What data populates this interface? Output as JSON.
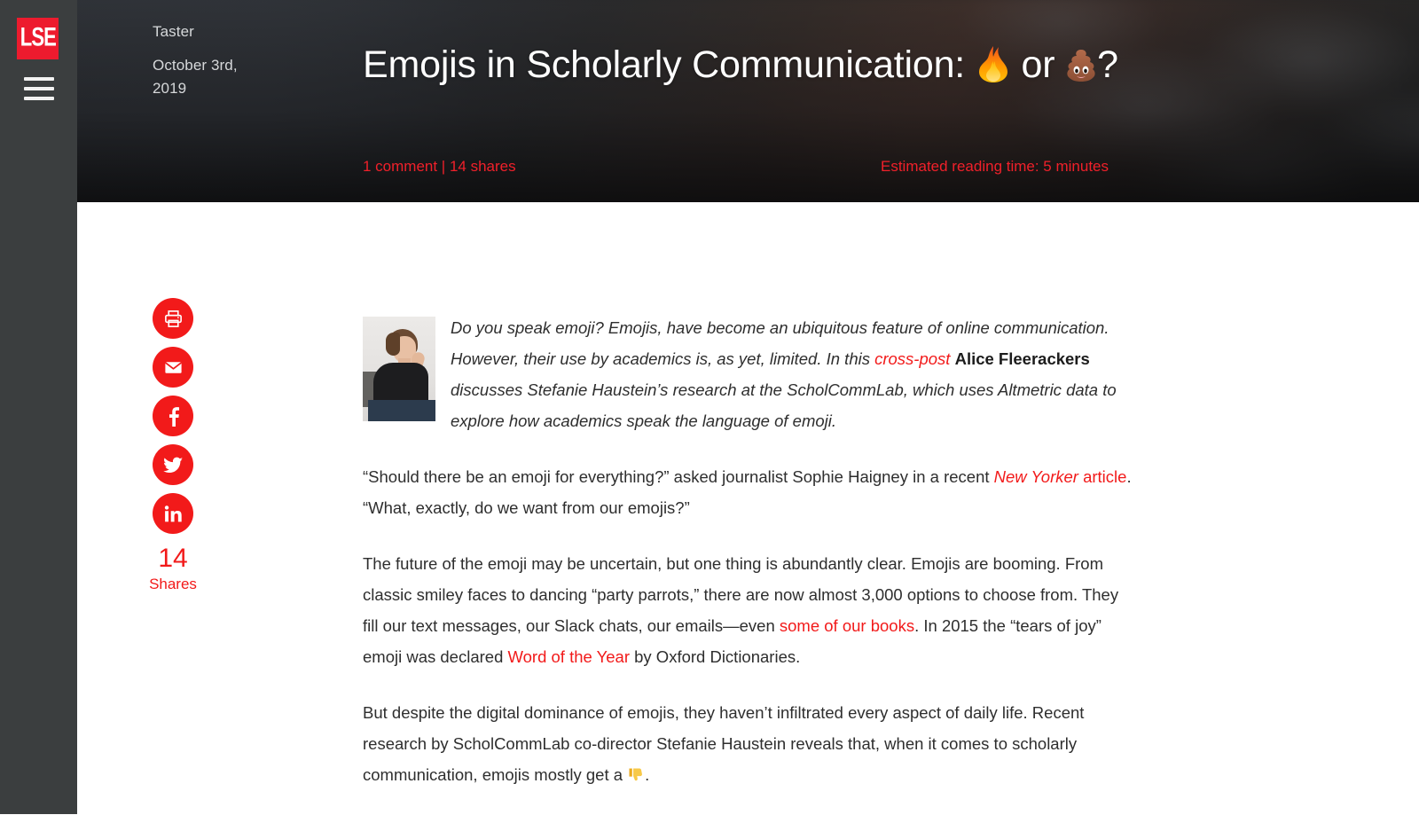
{
  "site": {
    "logo_text": "LSE",
    "logo_name": "lse-logo",
    "menu_icon": "hamburger-icon"
  },
  "banner": {
    "kicker": "Taster",
    "date": "October 3rd, 2019",
    "title_part1": "Emojis in Scholarly Communication: ",
    "title_emoji1": "fire-emoji",
    "title_part2": " or ",
    "title_emoji2": "poop-emoji",
    "title_part3": "?",
    "title_full": "Emojis in Scholarly Communication: 🔥 or 💩?",
    "meta_left": "1 comment | 14 shares",
    "meta_right": "Estimated reading time: 5 minutes",
    "comment_count": "1 comment",
    "share_count_text": "14 shares",
    "reading_time": "5 minutes",
    "accent_color": "#f0202a",
    "text_color": "#d6d8da"
  },
  "share_rail": {
    "buttons": [
      {
        "name": "print-button",
        "icon": "printer-icon",
        "label": "Print"
      },
      {
        "name": "email-button",
        "icon": "envelope-icon",
        "label": "Email"
      },
      {
        "name": "facebook-button",
        "icon": "facebook-icon",
        "label": "Facebook"
      },
      {
        "name": "twitter-button",
        "icon": "twitter-icon",
        "label": "Twitter"
      },
      {
        "name": "linkedin-button",
        "icon": "linkedin-icon",
        "label": "LinkedIn"
      }
    ],
    "count": "14",
    "count_label": "Shares",
    "color": "#f21a1a"
  },
  "article": {
    "author_photo_alt": "Alice Fleerackers portrait",
    "intro": {
      "s1": "Do you speak emoji? Emojis, have become an ubiquitous feature of online communication. However, their use by academics is, as yet, limited. In this ",
      "link1": "cross-post",
      "s2": " ",
      "author": "Alice Fleerackers",
      "s3": " discusses Stefanie Haustein’s research at the ScholCommLab, which uses Altmetric data to explore how academics speak the language of emoji."
    },
    "p1": {
      "s1": "“Should there be an emoji for everything?” asked journalist Sophie Haigney in a recent ",
      "link_italic": "New Yorker",
      "s2": " ",
      "link_plain": "article",
      "s3": ". “What, exactly, do we want from our emojis?”"
    },
    "p2": {
      "s1": "The future of the emoji may be uncertain, but one thing is abundantly clear. Emojis are booming. From classic smiley faces to dancing “party parrots,” there are now almost 3,000 options to choose from. They fill our text messages, our Slack chats, our emails—even ",
      "link1": "some of our books",
      "s2": ". In 2015 the “tears of joy” emoji was declared ",
      "link2": "Word of the Year",
      "s3": " by Oxford Dictionaries."
    },
    "p3": {
      "s1": "But despite the digital dominance of emojis, they haven’t infiltrated every aspect of daily life. Recent research by ScholCommLab co-director Stefanie Haustein reveals that, when it comes to scholarly communication, emojis mostly get a ",
      "emoji": "thumbs-down-emoji",
      "s2": "."
    }
  }
}
